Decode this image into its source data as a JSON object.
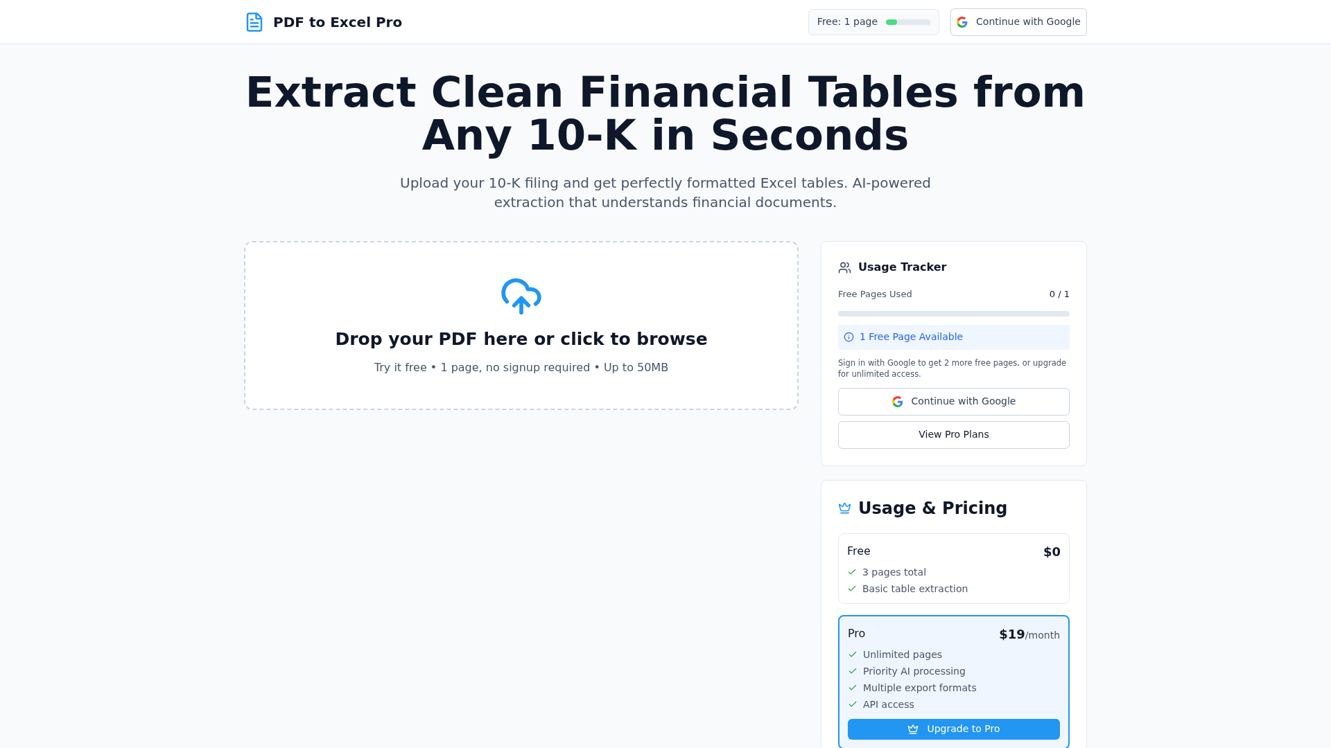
{
  "header": {
    "app_name": "PDF to Excel Pro",
    "quota": {
      "label": "Free: 1 page",
      "level": 0.25
    },
    "google_button": "Continue with Google"
  },
  "hero": {
    "title": "Extract Clean Financial Tables from Any 10-K in Seconds",
    "subtitle": "Upload your 10-K filing and get perfectly formatted Excel tables. AI-powered extraction that understands financial documents."
  },
  "dropzone": {
    "title": "Drop your PDF here or click to browse",
    "hint": "Try it free • 1 page, no signup required • Up to 50MB"
  },
  "usage_tracker": {
    "title": "Usage Tracker",
    "label": "Free Pages Used",
    "count": "0 / 1",
    "level": 0,
    "notice": "1 Free Page Available",
    "note": "Sign in with Google to get 2 more free pages, or upgrade for unlimited access.",
    "google_button": "Continue with Google",
    "plans_button": "View Pro Plans"
  },
  "pricing": {
    "title": "Usage & Pricing",
    "plans": [
      {
        "name": "Free",
        "price": "$0",
        "highlighted": false,
        "features": [
          "3 pages total",
          "Basic table extraction"
        ]
      },
      {
        "name": "Pro",
        "price": "$19",
        "period": "/month",
        "highlighted": true,
        "features": [
          "Unlimited pages",
          "Priority AI processing",
          "Multiple export formats",
          "API access"
        ],
        "button": "Upgrade to Pro"
      }
    ]
  }
}
